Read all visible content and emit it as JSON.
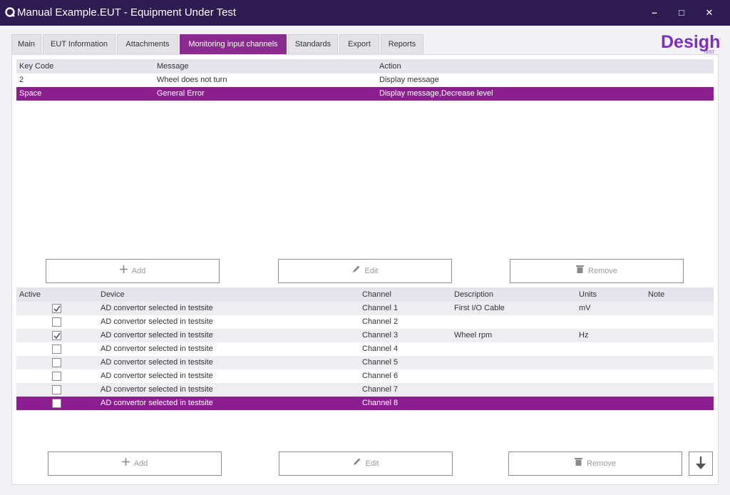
{
  "window": {
    "title": "Manual Example.EUT - Equipment Under Test",
    "minimize": "–",
    "maximize": "□",
    "close": "✕"
  },
  "tabs": [
    {
      "label": "Main"
    },
    {
      "label": "EUT Information"
    },
    {
      "label": "Attachments"
    },
    {
      "label": "Monitoring input channels",
      "active": true
    },
    {
      "label": "Standards"
    },
    {
      "label": "Export"
    },
    {
      "label": "Reports"
    }
  ],
  "logo": {
    "text": "Desight",
    "subtext": "TEST",
    "color": "#7a2fbf"
  },
  "keys_table": {
    "columns": [
      "Key Code",
      "Message",
      "Action"
    ],
    "rows": [
      {
        "key_code": "2",
        "message": "Wheel does not turn",
        "action": "Display message",
        "selected": false
      },
      {
        "key_code": "Space",
        "message": "General Error",
        "action": "Display message,Decrease level",
        "selected": true
      }
    ]
  },
  "keys_buttons": {
    "add": "Add",
    "edit": "Edit",
    "remove": "Remove"
  },
  "channels_table": {
    "columns": [
      "Active",
      "Device",
      "Channel",
      "Description",
      "Units",
      "Note"
    ],
    "rows": [
      {
        "active": true,
        "device": "AD convertor selected in testsite",
        "channel": "Channel 1",
        "description": "First I/O Cable",
        "units": "mV",
        "note": ""
      },
      {
        "active": false,
        "device": "AD convertor selected in testsite",
        "channel": "Channel 2",
        "description": "",
        "units": "",
        "note": ""
      },
      {
        "active": true,
        "device": "AD convertor selected in testsite",
        "channel": "Channel 3",
        "description": "Wheel rpm",
        "units": "Hz",
        "note": ""
      },
      {
        "active": false,
        "device": "AD convertor selected in testsite",
        "channel": "Channel 4",
        "description": "",
        "units": "",
        "note": ""
      },
      {
        "active": false,
        "device": "AD convertor selected in testsite",
        "channel": "Channel 5",
        "description": "",
        "units": "",
        "note": ""
      },
      {
        "active": false,
        "device": "AD convertor selected in testsite",
        "channel": "Channel 6",
        "description": "",
        "units": "",
        "note": ""
      },
      {
        "active": false,
        "device": "AD convertor selected in testsite",
        "channel": "Channel 7",
        "description": "",
        "units": "",
        "note": ""
      },
      {
        "active": false,
        "device": "AD convertor selected in testsite",
        "channel": "Channel 8",
        "description": "",
        "units": "",
        "note": "",
        "selected": true
      }
    ]
  },
  "channels_buttons": {
    "add": "Add",
    "edit": "Edit",
    "remove": "Remove",
    "move_down_icon": "arrow-down-icon"
  },
  "colors": {
    "titlebar": "#2d1b52",
    "accent": "#8b1f8f",
    "header_row": "#e6e5ed"
  }
}
